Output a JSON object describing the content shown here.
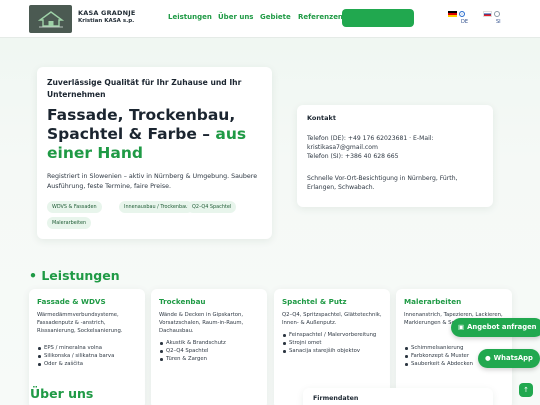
{
  "header": {
    "brand_name": "KASA GRADNJE",
    "brand_sub": "Kristian KASA s.p.",
    "nav": [
      "Leistungen",
      "Über uns",
      "Gebiete",
      "Referenzen"
    ],
    "lang_de": "DE",
    "lang_si": "SI"
  },
  "hero": {
    "kicker": "Zuverlässige Qualität für Ihr Zuhause und Ihr Unternehmen",
    "title_main": "Fassade, Trockenbau, Spachtel & Farbe – ",
    "title_accent": "aus einer Hand",
    "description": "Registriert in Slowenien – aktiv in Nürnberg & Umgebung. Saubere Ausführung, feste Termine, faire Preise.",
    "chips": [
      "WDVS & Fassaden",
      "Innenausbau / Trockenbau",
      "Q2–Q4 Spachtel",
      "Malerarbeiten"
    ]
  },
  "contact": {
    "title": "Kontakt",
    "phone_de": "Telefon (DE): +49 176 62023681 · E-Mail:",
    "email": "kristikasa7@gmail.com",
    "phone_si": "Telefon (SI): +386 40 628 665",
    "visit": "Schnelle Vor-Ort-Besichtigung in Nürnberg, Fürth, Erlangen, Schwabach."
  },
  "services": {
    "title": "Leistungen",
    "cards": [
      {
        "title": "Fassade & WDVS",
        "desc": "Wärmedämmverbundsysteme, Fassadenputz & -anstrich, Risssanierung, Sockelsanierung.",
        "items": [
          "EPS / mineralna volna",
          "Silikonska / silikatna barva",
          "Oder & zaščita"
        ]
      },
      {
        "title": "Trockenbau",
        "desc": "Wände & Decken in Gipskarton, Vorsatzschalen, Raum-in-Raum, Dachausbau.",
        "items": [
          "Akustik & Brandschutz",
          "Q2–Q4 Spachtel",
          "Türen & Zargen"
        ]
      },
      {
        "title": "Spachtel & Putz",
        "desc": "Q2–Q4, Spritzspachtel, Glättetechnik, Innen- & Außenputz.",
        "items": [
          "Feinspachtel / Malervorbereitung",
          "Strojni omet",
          "Sanacija starejših objektov"
        ]
      },
      {
        "title": "Malerarbeiten",
        "desc": "Innenanstrich, Tapezieren, Lackieren, Markierungen & Schutzanstriche.",
        "items": [
          "Schimmelsanierung",
          "Farbkonzept & Muster",
          "Sauberkeit & Abdecken"
        ]
      }
    ]
  },
  "about": {
    "title": "Über uns",
    "card_title": "Firmendaten"
  },
  "floating": {
    "quote": "Angebot anfragen",
    "whatsapp": "WhatsApp",
    "scroll_top": "↑"
  },
  "colors": {
    "accent": "#1f9a45",
    "button": "#21a84f"
  }
}
